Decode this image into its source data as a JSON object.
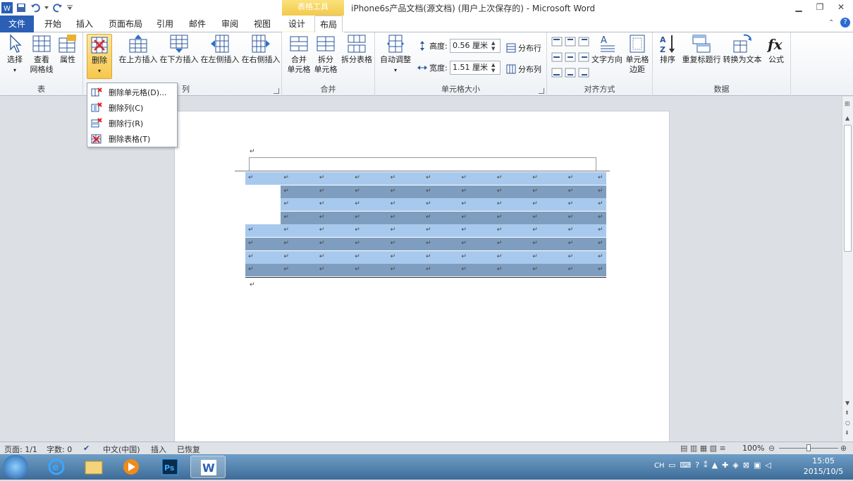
{
  "window": {
    "title": "iPhone6s产品文档(源文档) (用户上次保存的) - Microsoft Word",
    "context_tab_group": "表格工具"
  },
  "tabs": [
    "文件",
    "开始",
    "插入",
    "页面布局",
    "引用",
    "邮件",
    "审阅",
    "视图",
    "设计",
    "布局"
  ],
  "active_tab": "布局",
  "ribbon": {
    "table_group": {
      "label": "表",
      "select": "选择",
      "gridlines_l1": "查看",
      "gridlines_l2": "网格线",
      "properties": "属性"
    },
    "rows_cols_group": {
      "label": "行和列",
      "label_visible": "列",
      "delete": "删除",
      "insert_above": "在上方插入",
      "insert_below": "在下方插入",
      "insert_left": "在左侧插入",
      "insert_right": "在右侧插入"
    },
    "merge_group": {
      "label": "合并",
      "merge_l1": "合并",
      "merge_l2": "单元格",
      "split_l1": "拆分",
      "split_l2": "单元格",
      "split_table": "拆分表格"
    },
    "cell_size_group": {
      "label": "单元格大小",
      "autofit": "自动调整",
      "height_label": "高度:",
      "height_value": "0.56 厘米",
      "width_label": "宽度:",
      "width_value": "1.51 厘米",
      "distribute_rows": "分布行",
      "distribute_cols": "分布列"
    },
    "alignment_group": {
      "label": "对齐方式",
      "text_direction": "文字方向",
      "cell_margins_l1": "单元格",
      "cell_margins_l2": "边距"
    },
    "data_group": {
      "label": "数据",
      "sort": "排序",
      "repeat_header": "重复标题行",
      "convert_to_text": "转换为文本",
      "formula": "公式"
    }
  },
  "delete_menu": {
    "items": [
      "删除单元格(D)...",
      "删除列(C)",
      "删除行(R)",
      "删除表格(T)"
    ]
  },
  "document": {
    "paragraph_mark": "↵"
  },
  "status_bar": {
    "page": "页面: 1/1",
    "words": "字数: 0",
    "language": "中文(中国)",
    "insert_mode": "插入",
    "recovered": "已恢复",
    "zoom": "100%"
  },
  "taskbar": {
    "ime": "CH",
    "time": "15:05",
    "date": "2015/10/5"
  },
  "colors": {
    "selection_light": "#a8c9ee",
    "selection_dark": "#7f9ebf",
    "file_tab": "#2a5fb5",
    "context_tab": "#f2c94c"
  }
}
